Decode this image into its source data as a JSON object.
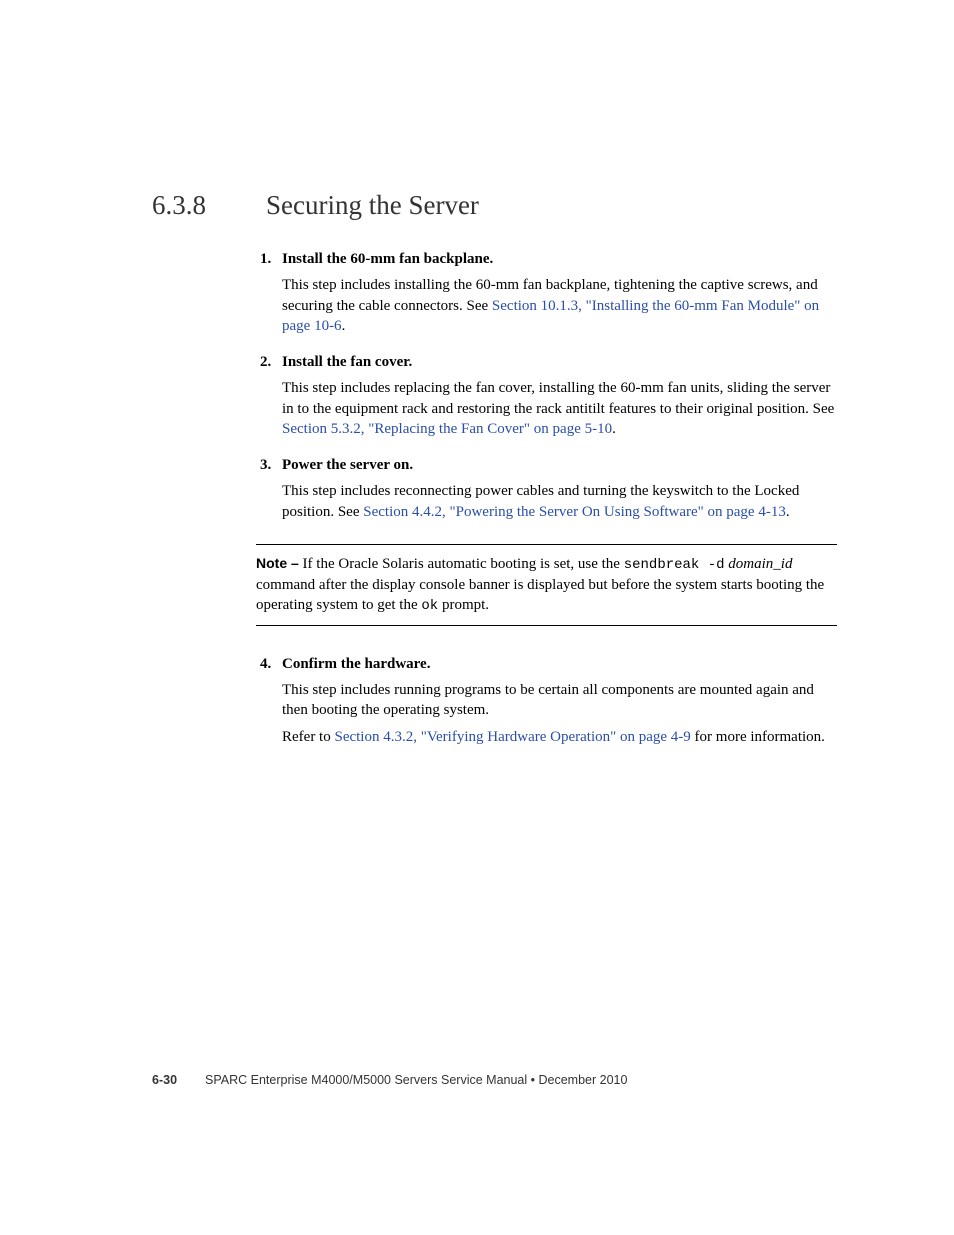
{
  "heading": {
    "number": "6.3.8",
    "title": "Securing the Server"
  },
  "steps": [
    {
      "title": "Install the 60-mm fan backplane.",
      "body_pre": "This step includes installing the 60-mm fan backplane, tightening the captive screws, and securing the cable connectors. See ",
      "link": "Section 10.1.3, \"Installing the 60-mm Fan Module\" on page 10-6",
      "body_post": "."
    },
    {
      "title": "Install the fan cover.",
      "body_pre": "This step includes replacing the fan cover, installing the 60-mm fan units, sliding the server in to the equipment rack and restoring the rack antitilt features to their original position. See ",
      "link": "Section 5.3.2, \"Replacing the Fan Cover\" on page 5-10",
      "body_post": "."
    },
    {
      "title": "Power the server on.",
      "body_pre": "This step includes reconnecting power cables and turning the keyswitch to the Locked position. See ",
      "link": "Section 4.4.2, \"Powering the Server On Using Software\" on page 4-13",
      "body_post": "."
    }
  ],
  "note": {
    "label": "Note –",
    "pre": " If the Oracle Solaris automatic booting is set, use the ",
    "code1": "sendbreak -d",
    "mid1": " ",
    "italic": "domain_id",
    "mid2": " command after the display console banner is displayed but before the system starts booting the operating system to get the ",
    "code2": "ok",
    "post": " prompt."
  },
  "step4": {
    "title": "Confirm the hardware.",
    "body1": "This step includes running programs to be certain all components are mounted again and then booting the operating system.",
    "body2_pre": "Refer to ",
    "link": "Section 4.3.2, \"Verifying Hardware Operation\" on page 4-9",
    "body2_post": " for more information."
  },
  "footer": {
    "pagenum": "6-30",
    "text": "SPARC Enterprise M4000/M5000 Servers Service Manual • December 2010"
  }
}
